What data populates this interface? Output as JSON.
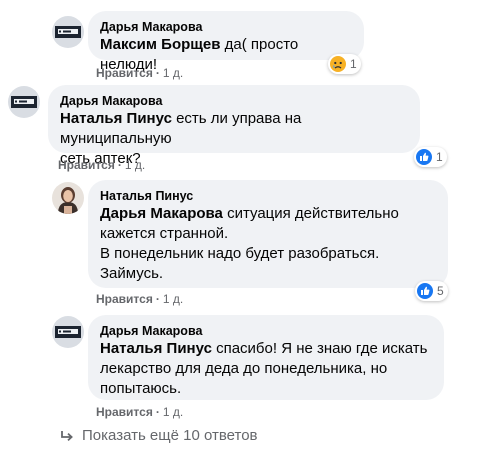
{
  "comments": [
    {
      "author": "Дарья Макарова",
      "mention": "Максим Борщев",
      "lines": [
        " да( просто нелюди!"
      ],
      "like_label": "Нравится",
      "time": "1 д.",
      "reaction_count": "1",
      "reaction_icon": "sad-face-icon"
    },
    {
      "author": "Дарья Макарова",
      "mention": "Наталья Пинус",
      "lines": [
        " есть ли управа на муниципальную",
        "сеть аптек?"
      ],
      "like_label": "Нравится",
      "time": "1 д.",
      "reaction_count": "1",
      "reaction_icon": "like-thumb-icon"
    },
    {
      "author": "Наталья Пинус",
      "mention": "Дарья Макарова",
      "lines": [
        " ситуация действительно",
        "кажется странной.",
        "В понедельник надо будет разобраться.",
        "Займусь."
      ],
      "like_label": "Нравится",
      "time": "1 д.",
      "reaction_count": "5",
      "reaction_icon": "like-thumb-icon"
    },
    {
      "author": "Дарья Макарова",
      "mention": "Наталья Пинус",
      "lines": [
        " спасибо! Я не знаю где искать",
        "лекарство для деда до понедельника, но",
        "попытаюсь."
      ],
      "like_label": "Нравится",
      "time": "1 д."
    }
  ],
  "more_replies": "Показать ещё 10 ответов",
  "colors": {
    "bubble": "#f0f2f5",
    "meta": "#65676b",
    "like_blue": "#1877f2",
    "sad_yellow": "#f7b125"
  }
}
